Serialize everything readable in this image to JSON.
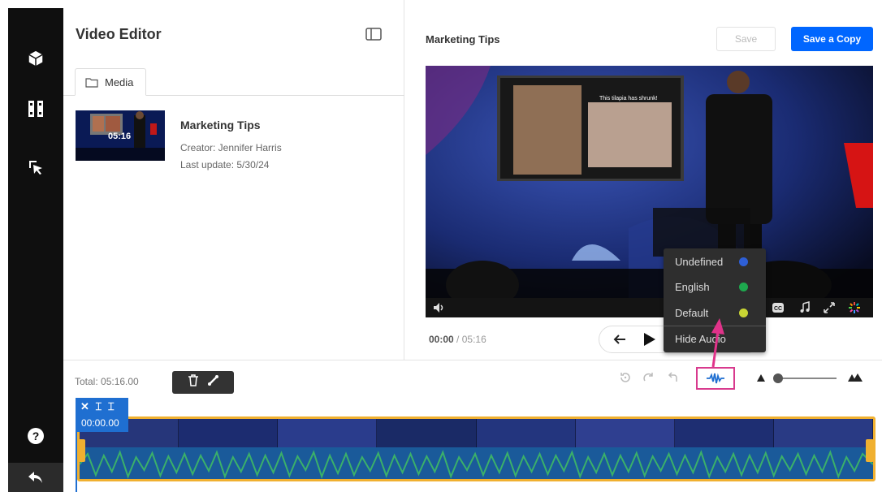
{
  "colors": {
    "accent": "#0066ff",
    "highlight": "#d83a8e",
    "clip": "#f0b030"
  },
  "sidebar": {
    "icons": [
      "cube-icon",
      "film-icon",
      "cursor-select-icon",
      "help-icon",
      "back-icon"
    ]
  },
  "editor": {
    "title": "Video Editor"
  },
  "media_tab": {
    "label": "Media"
  },
  "entry": {
    "name": "Marketing Tips",
    "duration": "05:16",
    "creator": "Creator: Jennifer Harris",
    "updated": "Last update: 5/30/24"
  },
  "player": {
    "title": "Marketing Tips",
    "save_label": "Save",
    "save_copy_label": "Save a Copy",
    "current_time": "00:00",
    "separator": "/",
    "duration": "05:16",
    "slide_caption": "This tilapia has shrunk!"
  },
  "timeline": {
    "total": "Total: 05:16.00",
    "clip_time": "00:00.00"
  },
  "audio_menu": {
    "items": [
      {
        "label": "Undefined",
        "color": "#2e5fd6"
      },
      {
        "label": "English",
        "color": "#1ea84e"
      },
      {
        "label": "Default",
        "color": "#c9d534"
      }
    ],
    "hide_label": "Hide Audio"
  }
}
